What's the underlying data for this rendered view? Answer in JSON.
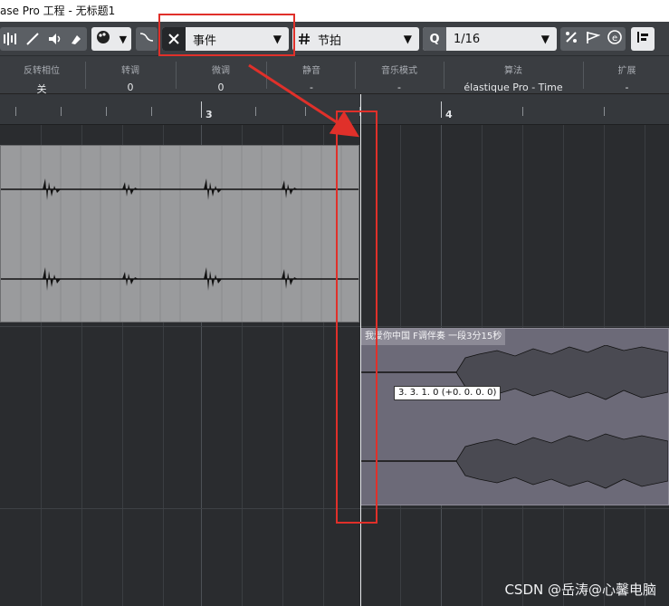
{
  "title_bar": {
    "text": "ase Pro 工程 - 无标题1"
  },
  "toolbar": {
    "snap_type_label": "事件",
    "grid_type_label": "节拍",
    "quantize_icon_letter": "Q",
    "quantize_value": "1/16",
    "icon_names": [
      "level-icon",
      "line-tool-icon",
      "speaker-icon",
      "color-tool-icon",
      "palette-icon",
      "curve-icon",
      "snap-x-icon",
      "grid-hash-icon",
      "quantize-icon",
      "iq-icon",
      "flag-icon",
      "e-icon",
      "align-icon"
    ]
  },
  "info_line": {
    "columns": [
      {
        "header": "反转相位",
        "value": "关"
      },
      {
        "header": "转调",
        "value": "0"
      },
      {
        "header": "微调",
        "value": "0"
      },
      {
        "header": "静音",
        "value": "-"
      },
      {
        "header": "音乐模式",
        "value": "-"
      },
      {
        "header": "算法",
        "value": "élastique Pro - Time"
      },
      {
        "header": "扩展",
        "value": "-"
      }
    ]
  },
  "ruler": {
    "bars": [
      "3",
      "4"
    ]
  },
  "events": {
    "event2_name": "我爱你中国 F调伴奏 一段3分15秒",
    "position_tooltip": "3. 3. 1. 0 (+0. 0. 0. 0)"
  },
  "colors": {
    "annotation_red": "#e0302a",
    "event1_bg": "#9a9b9d",
    "event2_bg": "#6c6a78",
    "toolbar_bg": "#3c3f43"
  },
  "watermark": {
    "text": "CSDN @岳涛@心馨电脑"
  }
}
